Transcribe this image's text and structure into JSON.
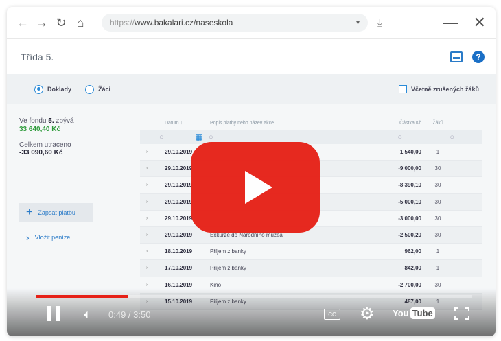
{
  "browser": {
    "url_protocol": "https://",
    "url_rest": "www.bakalari.cz/naseskola"
  },
  "app": {
    "title": "Třída 5."
  },
  "filters": {
    "radio_payments": "Doklady",
    "radio_students": "Žáci",
    "checkbox_label": "Včetně zrušených žáků"
  },
  "sidebar": {
    "fund_prefix": "Ve fondu",
    "fund_class": "5.",
    "fund_suffix": "zbývá",
    "fund_amount": "33 640,40 Kč",
    "spent_label": "Celkem utraceno",
    "spent_amount": "-33 090,60 Kč",
    "pay_button": "Zapsat platbu",
    "deposit_button": "Vložit peníze"
  },
  "table": {
    "headers": {
      "date": "Datum",
      "description": "Popis platby nebo název akce",
      "amount": "Částka Kč",
      "students": "Žáků"
    },
    "rows": [
      {
        "date": "29.10.2019",
        "desc": "",
        "amount": "1 540,00",
        "students": "1"
      },
      {
        "date": "29.10.2019",
        "desc": "",
        "amount": "-9 000,00",
        "students": "30"
      },
      {
        "date": "29.10.2019",
        "desc": "",
        "amount": "-8 390,10",
        "students": "30"
      },
      {
        "date": "29.10.2019",
        "desc": "",
        "amount": "-5 000,10",
        "students": "30"
      },
      {
        "date": "29.10.2019",
        "desc": "",
        "amount": "-3 000,00",
        "students": "30"
      },
      {
        "date": "29.10.2019",
        "desc": "Exkurze do Národního muzea",
        "amount": "-2 500,20",
        "students": "30"
      },
      {
        "date": "18.10.2019",
        "desc": "Příjem z banky",
        "amount": "962,00",
        "students": "1"
      },
      {
        "date": "17.10.2019",
        "desc": "Příjem z banky",
        "amount": "842,00",
        "students": "1"
      },
      {
        "date": "16.10.2019",
        "desc": "Kino",
        "amount": "-2 700,00",
        "students": "30"
      },
      {
        "date": "15.10.2019",
        "desc": "Příjem z banky",
        "amount": "487,00",
        "students": "1"
      }
    ]
  },
  "player": {
    "time": "0:49 / 3:50",
    "cc": "CC",
    "logo_you": "You",
    "logo_tube": "Tube",
    "progress": 0.21,
    "accent": "#e62117"
  }
}
